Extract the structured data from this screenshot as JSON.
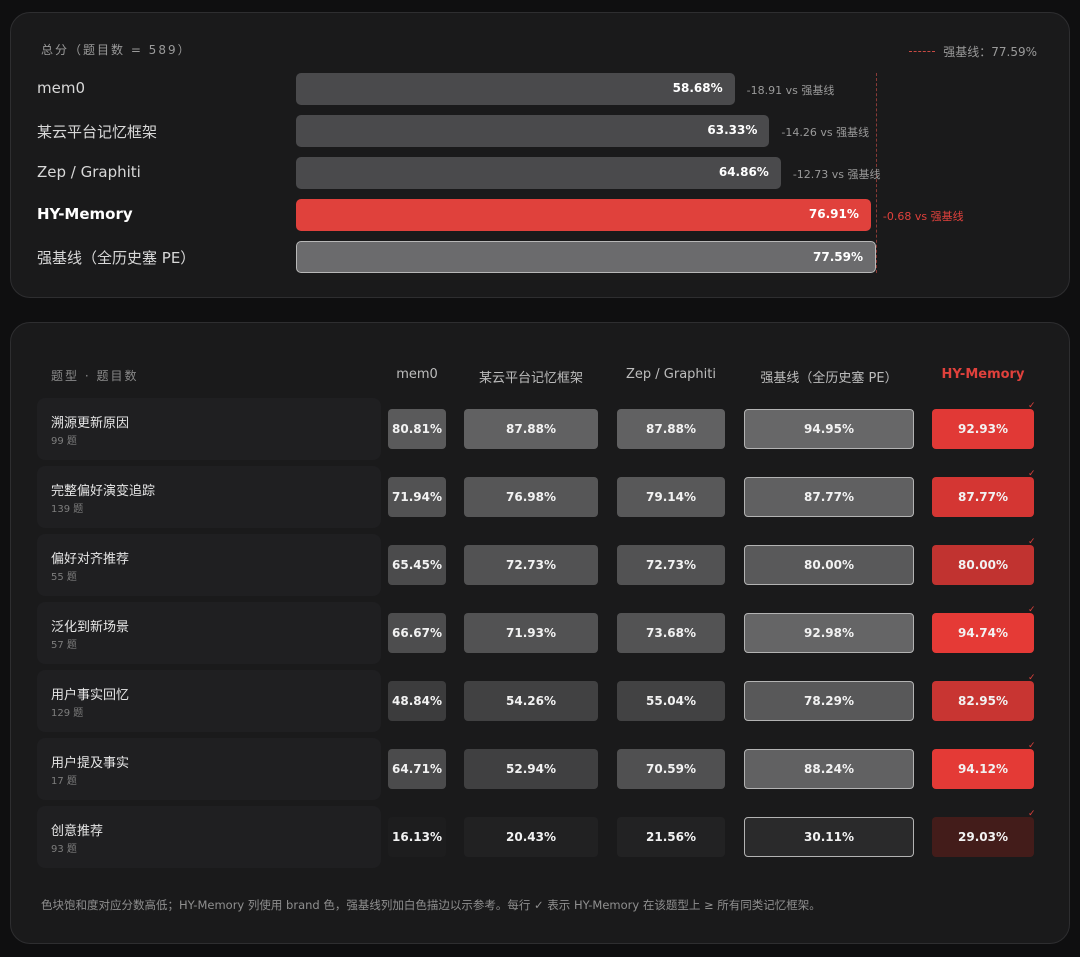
{
  "summary": {
    "heading": "总分（题目数 = 589）",
    "legend_label": "强基线：77.59%",
    "delta_suffix": " vs 强基线",
    "bars": [
      {
        "name": "mem0",
        "value": 58.68,
        "value_label": "58.68%",
        "delta": "-18.91",
        "kind": "normal"
      },
      {
        "name": "某云平台记忆框架",
        "value": 63.33,
        "value_label": "63.33%",
        "delta": "-14.26",
        "kind": "normal"
      },
      {
        "name": "Zep / Graphiti",
        "value": 64.86,
        "value_label": "64.86%",
        "delta": "-12.73",
        "kind": "normal"
      },
      {
        "name": "HY-Memory",
        "value": 76.91,
        "value_label": "76.91%",
        "delta": "-0.68",
        "kind": "highlight"
      },
      {
        "name": "强基线（全历史塞 PE）",
        "value": 77.59,
        "value_label": "77.59%",
        "delta": "",
        "kind": "baseline"
      }
    ]
  },
  "table": {
    "first_header": "题型 · 题目数",
    "columns": [
      "mem0",
      "某云平台记忆框架",
      "Zep / Graphiti",
      "强基线（全历史塞 PE）",
      "HY-Memory"
    ],
    "check_mark": "✓",
    "rows": [
      {
        "name": "溯源更新原因",
        "count": "99 题",
        "values": [
          80.81,
          87.88,
          87.88,
          94.95,
          92.93
        ]
      },
      {
        "name": "完整偏好演变追踪",
        "count": "139 题",
        "values": [
          71.94,
          76.98,
          79.14,
          87.77,
          87.77
        ]
      },
      {
        "name": "偏好对齐推荐",
        "count": "55 题",
        "values": [
          65.45,
          72.73,
          72.73,
          80.0,
          80.0
        ]
      },
      {
        "name": "泛化到新场景",
        "count": "57 题",
        "values": [
          66.67,
          71.93,
          73.68,
          92.98,
          94.74
        ]
      },
      {
        "name": "用户事实回忆",
        "count": "129 题",
        "values": [
          48.84,
          54.26,
          55.04,
          78.29,
          82.95
        ]
      },
      {
        "name": "用户提及事实",
        "count": "17 题",
        "values": [
          64.71,
          52.94,
          70.59,
          88.24,
          94.12
        ]
      },
      {
        "name": "创意推荐",
        "count": "93 题",
        "values": [
          16.13,
          20.43,
          21.56,
          30.11,
          29.03
        ]
      }
    ],
    "footnote": "色块饱和度对应分数高低；HY-Memory 列使用 brand 色，强基线列加白色描边以示参考。每行 ✓ 表示 HY-Memory 在该题型上 ≥ 所有同类记忆框架。"
  },
  "colors": {
    "brand": "#e0413c",
    "neutral": "#4a4a4c",
    "baseline": "#6b6b6d"
  },
  "chart_data": [
    {
      "type": "bar",
      "title": "总分（题目数 = 589）",
      "orientation": "horizontal",
      "categories": [
        "mem0",
        "某云平台记忆框架",
        "Zep / Graphiti",
        "HY-Memory",
        "强基线（全历史塞 PE）"
      ],
      "values": [
        58.68,
        63.33,
        64.86,
        76.91,
        77.59
      ],
      "reference_line": {
        "label": "强基线",
        "value": 77.59
      },
      "xlim": [
        0,
        100
      ]
    },
    {
      "type": "heatmap",
      "rows": [
        "溯源更新原因",
        "完整偏好演变追踪",
        "偏好对齐推荐",
        "泛化到新场景",
        "用户事实回忆",
        "用户提及事实",
        "创意推荐"
      ],
      "columns": [
        "mem0",
        "某云平台记忆框架",
        "Zep / Graphiti",
        "强基线（全历史塞 PE）",
        "HY-Memory"
      ],
      "values": [
        [
          80.81,
          87.88,
          87.88,
          94.95,
          92.93
        ],
        [
          71.94,
          76.98,
          79.14,
          87.77,
          87.77
        ],
        [
          65.45,
          72.73,
          72.73,
          80.0,
          80.0
        ],
        [
          66.67,
          71.93,
          73.68,
          92.98,
          94.74
        ],
        [
          48.84,
          54.26,
          55.04,
          78.29,
          82.95
        ],
        [
          64.71,
          52.94,
          70.59,
          88.24,
          94.12
        ],
        [
          16.13,
          20.43,
          21.56,
          30.11,
          29.03
        ]
      ]
    }
  ]
}
